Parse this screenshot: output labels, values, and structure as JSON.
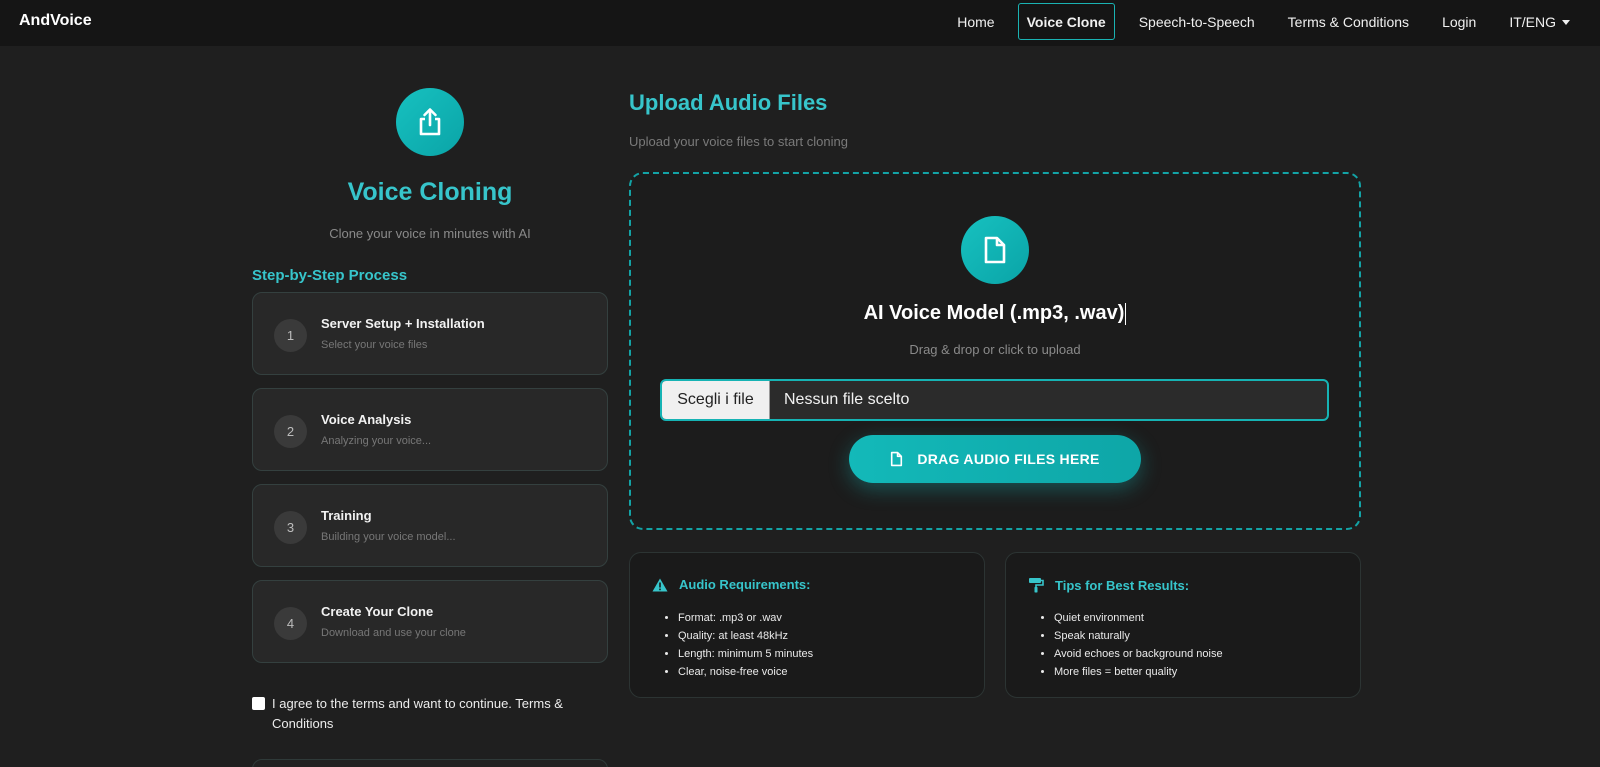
{
  "nav": {
    "brand": "AndVoice",
    "links": [
      {
        "label": "Home"
      },
      {
        "label": "Voice Clone"
      },
      {
        "label": "Speech-to-Speech"
      },
      {
        "label": "Terms & Conditions"
      },
      {
        "label": "Login"
      },
      {
        "label": "IT/ENG"
      }
    ],
    "active_color": "#1ab3b3"
  },
  "left": {
    "title": "Voice Cloning",
    "subtitle": "Clone your voice in minutes with AI",
    "steps_title": "Step-by-Step Process",
    "steps": [
      {
        "num": "1",
        "title": "Server Setup + Installation",
        "desc": "Select your voice files"
      },
      {
        "num": "2",
        "title": "Voice Analysis",
        "desc": "Analyzing your voice..."
      },
      {
        "num": "3",
        "title": "Training",
        "desc": "Building your voice model..."
      },
      {
        "num": "4",
        "title": "Create Your Clone",
        "desc": "Download and use your clone"
      }
    ],
    "agree_text": "I agree to the terms and want to continue. Terms & Conditions"
  },
  "upload": {
    "title": "Upload Audio Files",
    "subtitle": "Upload your voice files to start cloning",
    "dz_title": "AI Voice Model (.mp3, .wav)",
    "dz_sub": "Drag & drop or click to upload",
    "file_button": "Scegli i file",
    "file_status": "Nessun file scelto",
    "drag_button": "DRAG AUDIO FILES HERE"
  },
  "requirements": {
    "title": "Audio Requirements:",
    "items": [
      "Format: .mp3 or .wav",
      "Quality: at least 48kHz",
      "Length: minimum 5 minutes",
      "Clear, noise-free voice"
    ]
  },
  "tips": {
    "title": "Tips for Best Results:",
    "items": [
      "Quiet environment",
      "Speak naturally",
      "Avoid echoes or background noise",
      "More files = better quality"
    ]
  },
  "colors": {
    "accent": "#37c5cb",
    "teal": "#13b9b9",
    "background": "#1f1f1f"
  }
}
